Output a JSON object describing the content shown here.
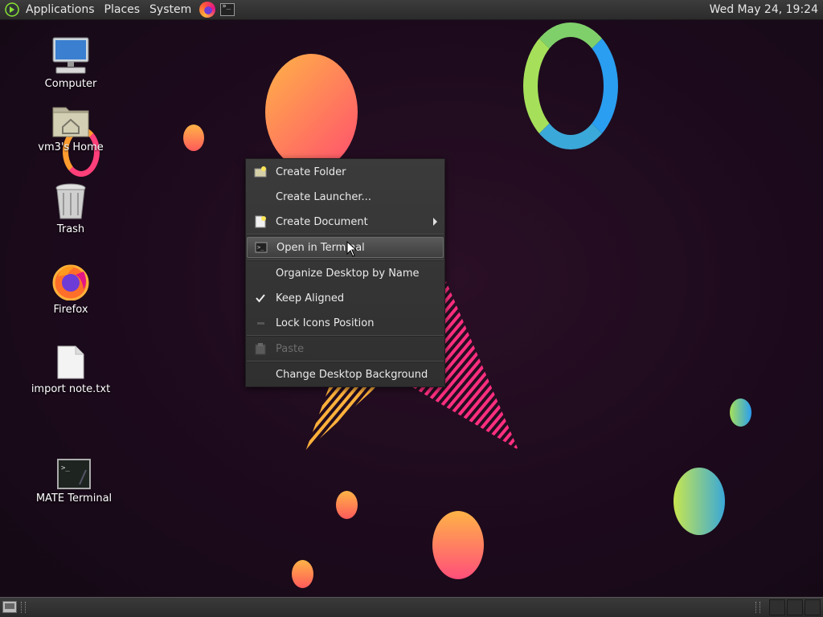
{
  "top_panel": {
    "menus": [
      "Applications",
      "Places",
      "System"
    ],
    "launchers": [
      "firefox-icon",
      "terminal-icon"
    ],
    "clock": "Wed May 24, 19:24"
  },
  "desktop_icons": [
    {
      "label": "Computer",
      "icon": "computer-icon"
    },
    {
      "label": "vm3's Home",
      "icon": "home-folder-icon"
    },
    {
      "label": "Trash",
      "icon": "trash-icon"
    },
    {
      "label": "Firefox",
      "icon": "firefox-icon"
    },
    {
      "label": "import note.txt",
      "icon": "text-file-icon"
    },
    {
      "label": "MATE Terminal",
      "icon": "terminal-icon"
    }
  ],
  "context_menu": {
    "items": [
      {
        "label": "Create Folder",
        "icon": "folder-new-icon"
      },
      {
        "label": "Create Launcher...",
        "icon": ""
      },
      {
        "label": "Create Document",
        "icon": "document-new-icon",
        "submenu": true
      },
      {
        "label": "Open in Terminal",
        "icon": "terminal-icon",
        "highlighted": true
      },
      {
        "label": "Organize Desktop by Name",
        "icon": ""
      },
      {
        "label": "Keep Aligned",
        "icon": "checkmark-icon",
        "checked": true
      },
      {
        "label": "Lock Icons Position",
        "icon": "",
        "checked": false
      },
      {
        "label": "Paste",
        "icon": "paste-icon",
        "disabled": true
      },
      {
        "label": "Change Desktop Background",
        "icon": ""
      }
    ]
  },
  "colors": {
    "background": "#1c0a1c",
    "menu_bg": "#353535",
    "highlight": "#4a4a4a"
  }
}
